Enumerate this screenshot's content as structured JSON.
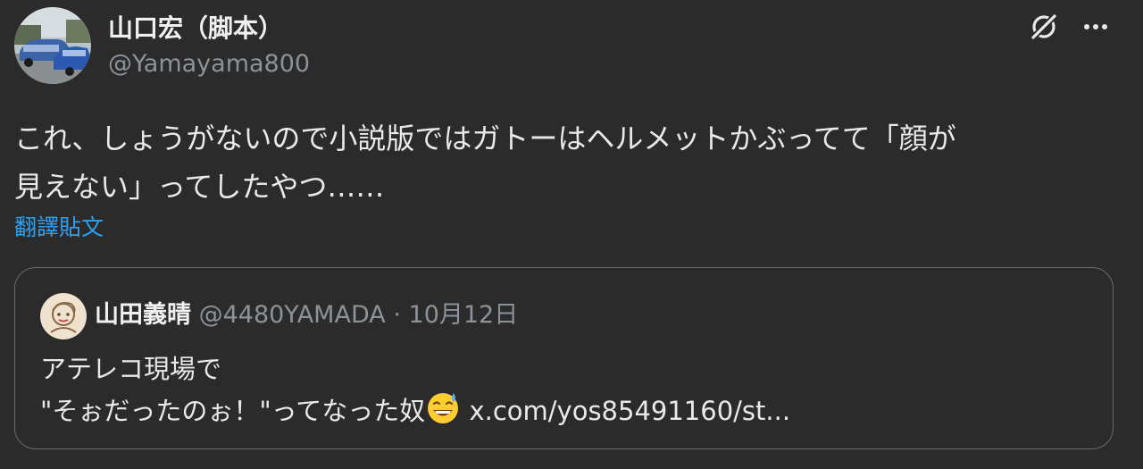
{
  "author": {
    "display_name": "山口宏（脚本）",
    "handle": "@Yamayama800"
  },
  "header": {
    "grok_icon": "grok-icon",
    "more_icon": "more-icon",
    "more_label": "•••"
  },
  "tweet": {
    "line1": "これ、しょうがないので小説版ではガトーはヘルメットかぶってて「顔が",
    "line2": "見えない」ってしたやつ……"
  },
  "translate_label": "翻譯貼文",
  "quote": {
    "name": "山田義晴",
    "handle": "@4480YAMADA",
    "separator": "·",
    "date": "10月12日",
    "line1": "アテレコ現場で",
    "line2_text": "\"そぉだったのぉ！\"ってなった奴",
    "emoji": "grinning-face-with-sweat-icon",
    "link": "x.com/yos85491160/st..."
  },
  "colors": {
    "background": "#2b2b2b",
    "text": "#e7e9ea",
    "secondary": "#8b9299",
    "link": "#2ea1f2",
    "border": "#6a6a6a"
  }
}
